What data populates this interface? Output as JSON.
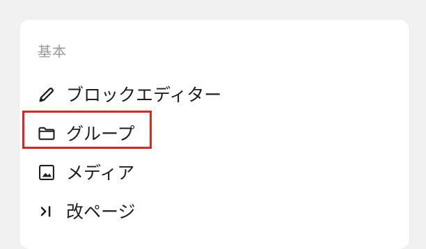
{
  "panel": {
    "section_title": "基本",
    "items": [
      {
        "label": "ブロックエディター",
        "icon": "pencil-icon"
      },
      {
        "label": "グループ",
        "icon": "folder-icon"
      },
      {
        "label": "メディア",
        "icon": "image-icon"
      },
      {
        "label": "改ページ",
        "icon": "page-break-icon"
      }
    ]
  },
  "colors": {
    "panel_bg": "#ffffff",
    "page_bg": "#f1f1f1",
    "text": "#1e1e1e",
    "muted": "#9a9a9a",
    "highlight": "#e2241b"
  }
}
